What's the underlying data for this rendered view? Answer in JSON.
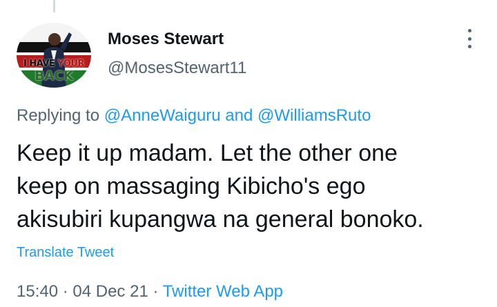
{
  "author": {
    "display_name": "Moses Stewart",
    "handle": "@MosesStewart11",
    "avatar_text_line1_a": "I HAVE",
    "avatar_text_line1_b": "YOUR",
    "avatar_text_line2": "BACK"
  },
  "reply": {
    "prefix": "Replying to ",
    "mention_1": "@AnneWaiguru",
    "joiner": " and ",
    "mention_2": "@WilliamsRuto"
  },
  "tweet": {
    "line_1": "Keep it up madam. Let the other one",
    "line_2": "keep on massaging Kibicho's ego",
    "line_3": "akisubiri kupangwa na general bonoko."
  },
  "translate_label": "Translate Tweet",
  "meta": {
    "time": "15:40",
    "separator": " · ",
    "date": "04 Dec 21",
    "source": "Twitter Web App"
  },
  "icons": {
    "more": "more-vertical-icon"
  },
  "colors": {
    "link": "#1d9bf0",
    "muted": "#536471",
    "text": "#0f1419"
  }
}
